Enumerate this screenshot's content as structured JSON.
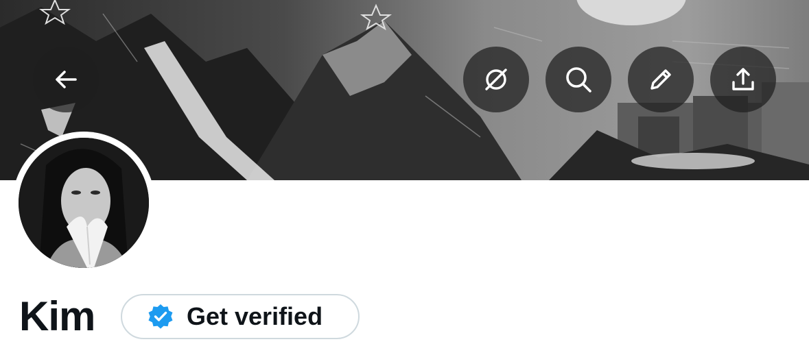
{
  "header": {
    "back_icon": "arrow-left-icon",
    "actions": [
      {
        "icon": "grok-icon"
      },
      {
        "icon": "search-icon"
      },
      {
        "icon": "pencil-icon"
      },
      {
        "icon": "share-icon"
      }
    ]
  },
  "profile": {
    "name": "Kim",
    "verify_label": "Get verified",
    "verify_badge_color": "#1d9bf0"
  },
  "colors": {
    "text": "#0f1419",
    "pill_border": "#cfd9de",
    "accent": "#1d9bf0"
  }
}
